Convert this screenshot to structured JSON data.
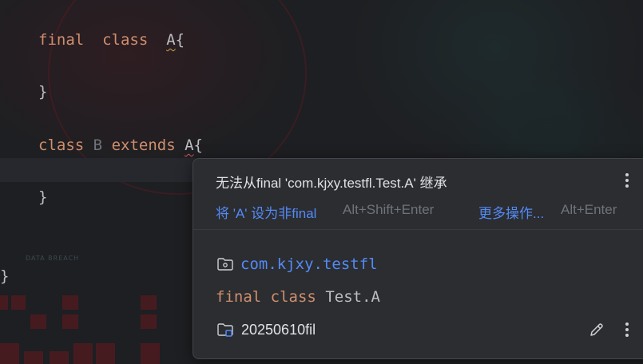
{
  "editor": {
    "lines": [
      {
        "kw": "final",
        "kw2": "class",
        "name": "A",
        "brace": "{"
      },
      {
        "text": "}"
      },
      {
        "kw": "class",
        "name": "B",
        "kw2": "extends",
        "parent": "A",
        "brace": "{"
      },
      {
        "text": "}"
      },
      {
        "text": "}"
      }
    ],
    "background_text": "DATA BREACH"
  },
  "popup": {
    "error_message": "无法从final 'com.kjxy.testfl.Test.A' 继承",
    "quick_fix": "将 'A' 设为非final",
    "quick_fix_shortcut": "Alt+Shift+Enter",
    "more_actions": "更多操作...",
    "more_actions_shortcut": "Alt+Enter",
    "package": "com.kjxy.testfl",
    "declaration_kw1": "final",
    "declaration_kw2": "class",
    "declaration_name": "Test.A",
    "module": "20250610fil"
  },
  "icons": {
    "menu": "more-vertical-icon",
    "package": "package-folder-icon",
    "module": "module-folder-icon",
    "edit": "pencil-icon"
  },
  "colors": {
    "editor_bg": "#1e1f22",
    "keyword": "#cf8e6d",
    "identifier": "#bcbec4",
    "link": "#548af7",
    "popup_bg": "#2b2d30"
  }
}
